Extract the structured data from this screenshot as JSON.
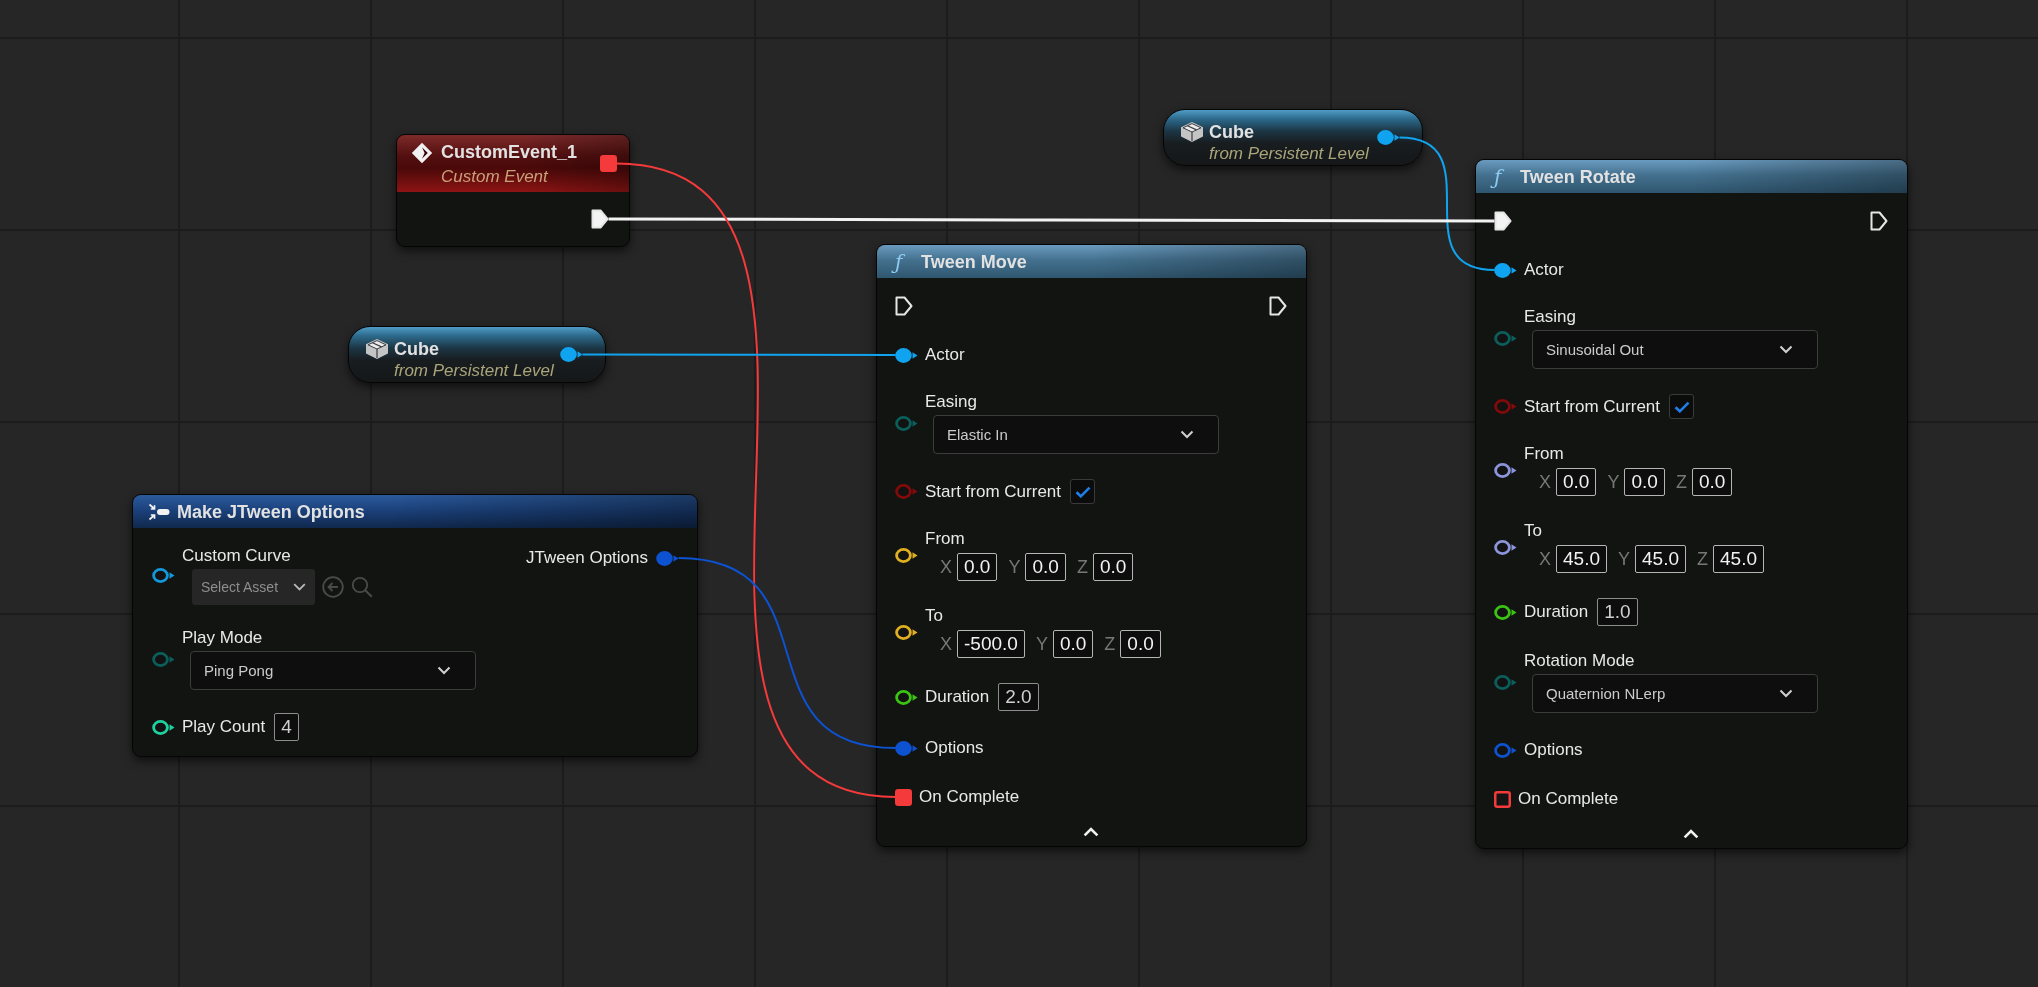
{
  "graph": {
    "nodes": [
      {
        "kind": "event",
        "title": "CustomEvent_1",
        "subtitle": "Custom Event",
        "delegate": {
          "color": "#f43a3a",
          "connected": true
        },
        "exec_out": {
          "connected": true
        }
      },
      {
        "kind": "variable",
        "title": "Cube",
        "subtitle": "from Persistent Level",
        "outputs": [
          {
            "color": "#10a4f0",
            "connected": true
          }
        ]
      },
      {
        "kind": "variable",
        "title": "Cube",
        "subtitle": "from Persistent Level",
        "outputs": [
          {
            "color": "#10a4f0",
            "connected": true
          }
        ]
      },
      {
        "kind": "make_struct",
        "title": "Make JTween Options",
        "inputs": [
          {
            "kind": "data",
            "label": "Custom Curve",
            "color": "#1398dc",
            "connected": false,
            "widget": {
              "kind": "asset",
              "placeholder": "Select Asset"
            }
          },
          {
            "kind": "data",
            "label": "Play Mode",
            "color": "#0b5f5a",
            "connected": false,
            "widget": {
              "kind": "dropdown",
              "value": "Ping Pong"
            }
          },
          {
            "kind": "data",
            "label": "Play Count",
            "color": "#1ed2a0",
            "connected": false,
            "widget": {
              "kind": "number",
              "value": "4"
            }
          }
        ],
        "outputs": [
          {
            "label": "JTween Options",
            "color": "#0d52d0",
            "connected": true
          }
        ]
      },
      {
        "kind": "function",
        "glyph": "ƒ",
        "title": "Tween Move",
        "exec_in": {
          "connected": false
        },
        "exec_out": {
          "connected": false
        },
        "inputs": [
          {
            "kind": "data",
            "label": "Actor",
            "color": "#10a4f0",
            "connected": true
          },
          {
            "kind": "data",
            "label": "Easing",
            "color": "#0b5f5a",
            "connected": false,
            "widget": {
              "kind": "dropdown",
              "value": "Elastic In"
            }
          },
          {
            "kind": "data",
            "label": "Start from Current",
            "color": "#820a0a",
            "connected": false,
            "widget": {
              "kind": "checkbox",
              "checked": true
            }
          },
          {
            "kind": "data",
            "label": "From",
            "color": "#e0b020",
            "connected": false,
            "widget": {
              "kind": "vector",
              "fields": [
                {
                  "axis": "X",
                  "value": "0.0"
                },
                {
                  "axis": "Y",
                  "value": "0.0"
                },
                {
                  "axis": "Z",
                  "value": "0.0"
                }
              ]
            }
          },
          {
            "kind": "data",
            "label": "To",
            "color": "#e0b020",
            "connected": false,
            "widget": {
              "kind": "vector",
              "fields": [
                {
                  "axis": "X",
                  "value": "-500.0"
                },
                {
                  "axis": "Y",
                  "value": "0.0"
                },
                {
                  "axis": "Z",
                  "value": "0.0"
                }
              ]
            }
          },
          {
            "kind": "data",
            "label": "Duration",
            "color": "#3cc414",
            "connected": false,
            "widget": {
              "kind": "number",
              "value": "2.0"
            }
          },
          {
            "kind": "data",
            "label": "Options",
            "color": "#0d52d0",
            "connected": true
          },
          {
            "kind": "delegate",
            "label": "On Complete",
            "color": "#f43a3a",
            "connected": true
          }
        ]
      },
      {
        "kind": "function",
        "glyph": "ƒ",
        "title": "Tween Rotate",
        "exec_in": {
          "connected": true
        },
        "exec_out": {
          "connected": false
        },
        "inputs": [
          {
            "kind": "data",
            "label": "Actor",
            "color": "#10a4f0",
            "connected": true
          },
          {
            "kind": "data",
            "label": "Easing",
            "color": "#0b5f5a",
            "connected": false,
            "widget": {
              "kind": "dropdown",
              "value": "Sinusoidal Out"
            }
          },
          {
            "kind": "data",
            "label": "Start from Current",
            "color": "#820a0a",
            "connected": false,
            "widget": {
              "kind": "checkbox",
              "checked": true
            }
          },
          {
            "kind": "data",
            "label": "From",
            "color": "#8c94dc",
            "connected": false,
            "widget": {
              "kind": "vector",
              "fields": [
                {
                  "axis": "X",
                  "value": "0.0"
                },
                {
                  "axis": "Y",
                  "value": "0.0"
                },
                {
                  "axis": "Z",
                  "value": "0.0"
                }
              ]
            }
          },
          {
            "kind": "data",
            "label": "To",
            "color": "#8c94dc",
            "connected": false,
            "widget": {
              "kind": "vector",
              "fields": [
                {
                  "axis": "X",
                  "value": "45.0"
                },
                {
                  "axis": "Y",
                  "value": "45.0"
                },
                {
                  "axis": "Z",
                  "value": "45.0"
                }
              ]
            }
          },
          {
            "kind": "data",
            "label": "Duration",
            "color": "#3cc414",
            "connected": false,
            "widget": {
              "kind": "number",
              "value": "1.0"
            }
          },
          {
            "kind": "data",
            "label": "Rotation Mode",
            "color": "#0b5f5a",
            "connected": false,
            "widget": {
              "kind": "dropdown",
              "value": "Quaternion NLerp"
            }
          },
          {
            "kind": "data",
            "label": "Options",
            "color": "#0d52d0",
            "connected": false
          },
          {
            "kind": "delegate",
            "label": "On Complete",
            "color": "#f43a3a",
            "connected": false
          }
        ]
      }
    ]
  }
}
